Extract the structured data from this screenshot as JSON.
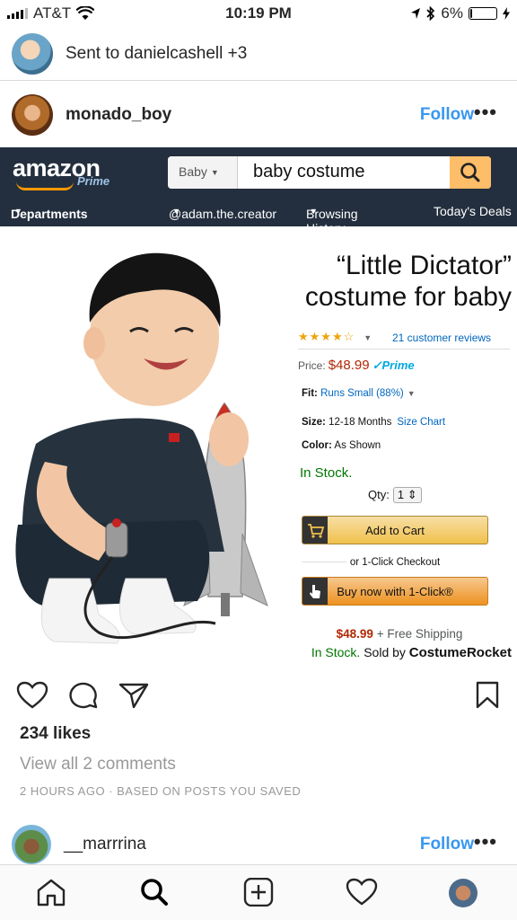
{
  "status_bar": {
    "carrier": "AT&T",
    "time": "10:19 PM",
    "battery": "6%",
    "battery_fraction": 0.06
  },
  "direct": {
    "sent_text": "Sent to danielcashell +3"
  },
  "post": {
    "username": "monado_boy",
    "follow_label": "Follow",
    "more_label": "•••",
    "likes": "234 likes",
    "view_comments": "View all 2 comments",
    "timestamp": "2 HOURS AGO · BASED ON POSTS YOU SAVED"
  },
  "amazon": {
    "logo": "amazon",
    "prime": "Prime",
    "search_category": "Baby",
    "search_query": "baby costume",
    "nav": {
      "departments": "Departments",
      "creator": "@adam.the.creator",
      "browsing_history": "Browsing History",
      "todays_deals": "Today's Deals"
    },
    "product": {
      "title_line1": "“Little Dictator”",
      "title_line2": "costume for baby",
      "rating_stars": "★★★★☆",
      "reviews": "21 customer reviews",
      "price_label": "Price:",
      "price": "$48.99",
      "prime_badge": "✓Prime",
      "fit_label": "Fit:",
      "fit_value": "Runs Small (88%)",
      "size_label": "Size:",
      "size_value": "12-18 Months",
      "size_chart": "Size Chart",
      "color_label": "Color:",
      "color_value": "As Shown",
      "in_stock": "In Stock.",
      "qty_label": "Qty:",
      "qty_value": "1",
      "add_to_cart": "Add to Cart",
      "one_click_checkout": "or 1-Click Checkout",
      "buy_now": "Buy now with 1-Click®",
      "shipping_price": "$48.99",
      "shipping_text": "+ Free Shipping",
      "sold_in_stock": "In Stock.",
      "sold_by": "Sold by",
      "seller": "CostumeRocket"
    }
  },
  "next_post": {
    "username": "__marrrina",
    "follow_label": "Follow",
    "more_label": "•••"
  },
  "icons": {
    "like": "heart-icon",
    "comment": "comment-icon",
    "share": "paper-plane-icon",
    "save": "bookmark-icon",
    "home": "home-icon",
    "search": "search-icon",
    "add": "plus-square-icon",
    "activity": "heart-icon"
  },
  "colors": {
    "instagram_blue": "#3897f0",
    "amazon_navy": "#232f3e",
    "amazon_orange": "#febd69",
    "price_red": "#b12704",
    "stock_green": "#007600"
  }
}
